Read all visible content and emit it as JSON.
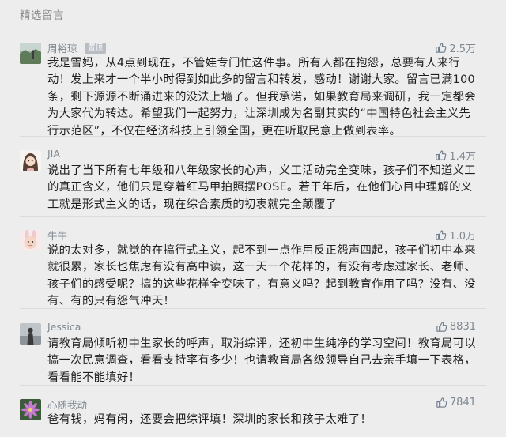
{
  "section_title": "精选留言",
  "comments": [
    {
      "nickname": "周裕琼",
      "tag": "置顶",
      "likes": "2.5万",
      "avatar_icon": "landscape-photo-avatar-icon",
      "text": "我是雪妈，从4点到现在，不管娃专门忙这件事。所有人都在抱怨，总要有人来行动！发上来才一个半小时得到如此多的留言和转发，感动！谢谢大家。留言已满100条，剩下源源不断涌进来的没法上墙了。但我承诺，如果教育局来调研，我一定都会为大家代为转达。希望我们一起努力，让深圳成为名副其实的“中国特色社会主义先行示范区”，不仅在经济科技上引领全国，更在听取民意上做到表率。"
    },
    {
      "nickname": "JIA",
      "likes": "1.4万",
      "avatar_icon": "cartoon-girl-avatar-icon",
      "text": "说出了当下所有七年级和八年级家长的心声，义工活动完全变味，孩子们不知道义工的真正含义，他们只是穿着红马甲拍照摆POSE。若干年后，在他们心目中理解的义工就是形式主义的话，现在综合素质的初衷就完全颠覆了"
    },
    {
      "nickname": "牛牛",
      "likes": "1.0万",
      "avatar_icon": "cartoon-bunny-avatar-icon",
      "text": "说的太对多，就觉的在搞行式主义，起不到一点作用反正怨声四起，孩子们初中本来就很累，家长也焦虑有没有高中读，这一天一个花样的，有没有考虑过家长、老师、孩子们的感受呢？搞的这些花样全变味了，有意义吗？起到教育作用了吗？没有、没有、有的只有怨气冲天！"
    },
    {
      "nickname": "Jessica",
      "likes": "8831",
      "avatar_icon": "person-silhouette-avatar-icon",
      "text": "请教育局倾听初中生家长的呼声，取消综评，还初中生纯净的学习空间！教育局可以搞一次民意调查，看看支持率有多少！也请教育局各级领导自己去亲手填一下表格，看看能不能填好！"
    },
    {
      "nickname": "心随我动",
      "likes": "7841",
      "avatar_icon": "flower-avatar-icon",
      "text": "爸有钱，妈有闲，还要会把综评填！深圳的家长和孩子太难了！"
    }
  ],
  "colors": {
    "background": "#ededed",
    "meta_text": "#7f8892",
    "body_text": "#1e1e1e",
    "tag_bg": "#b8bcc3"
  }
}
